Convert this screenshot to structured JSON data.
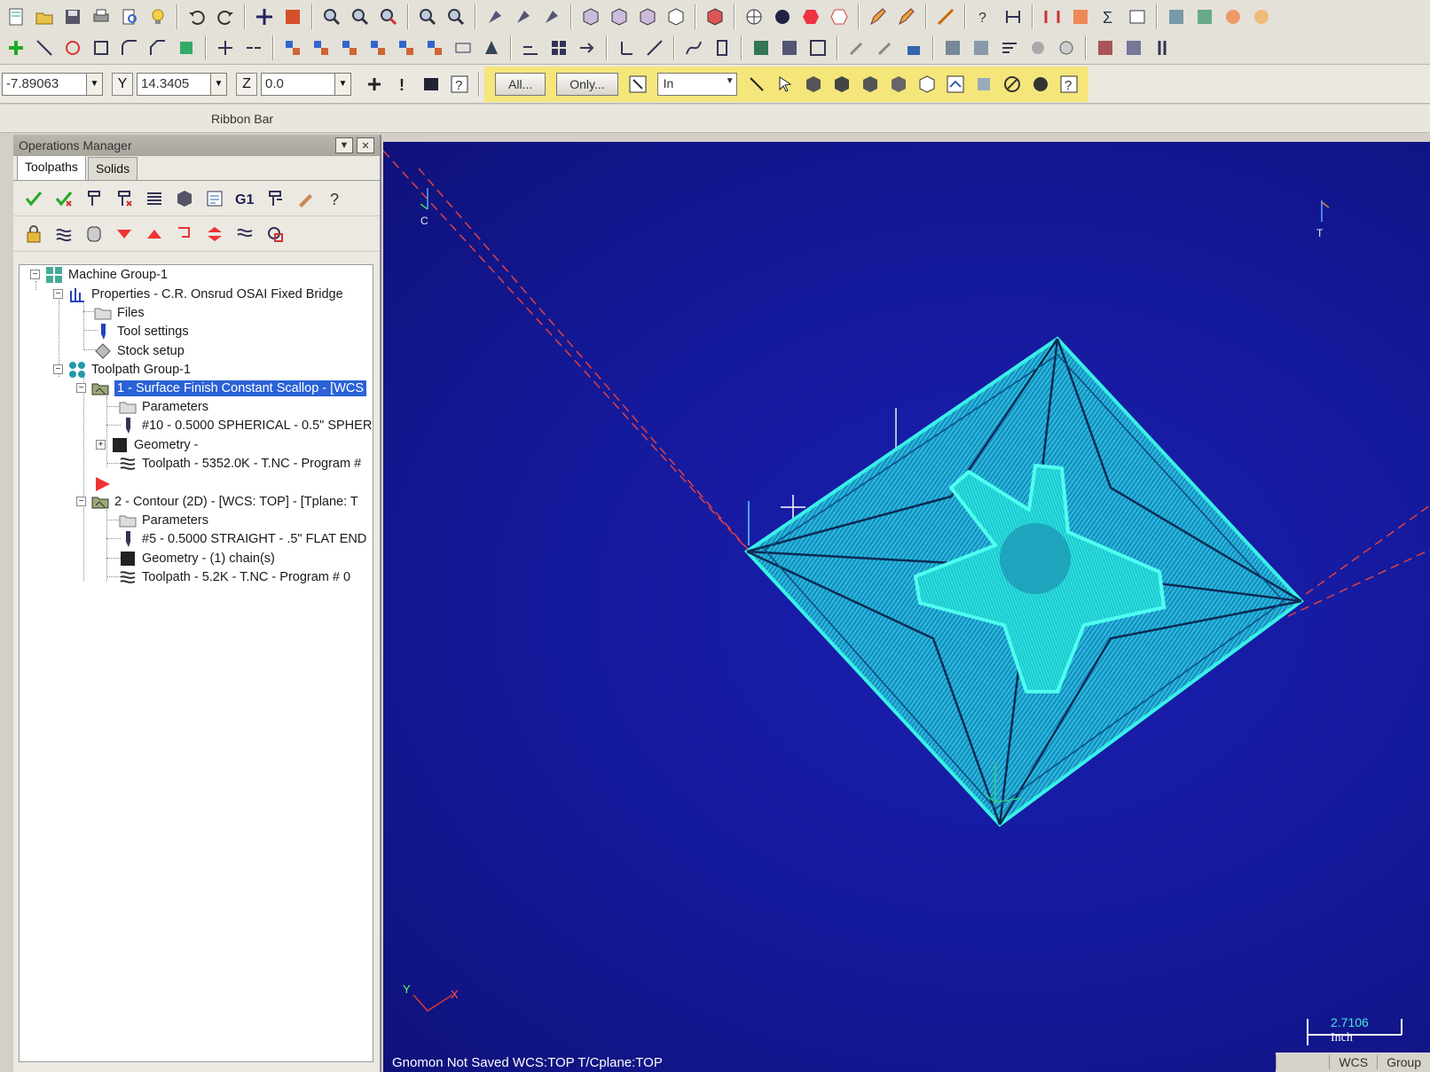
{
  "coords": {
    "x_value": "-7.89063",
    "y_label": "Y",
    "y_value": "14.3405",
    "z_label": "Z",
    "z_value": "0.0"
  },
  "ribbon": {
    "btn_all": "All...",
    "btn_only": "Only...",
    "units_select": "In",
    "label": "Ribbon Bar"
  },
  "ops_manager": {
    "title": "Operations Manager",
    "tabs": [
      "Toolpaths",
      "Solids"
    ],
    "g1_label": "G1",
    "tree": [
      "Machine Group-1",
      "Properties - C.R. Onsrud OSAI Fixed Bridge",
      "Files",
      "Tool settings",
      "Stock setup",
      "Toolpath Group-1",
      "1 - Surface Finish Constant Scallop - [WCS",
      "Parameters",
      "#10 - 0.5000 SPHERICAL - 0.5\" SPHER",
      "Geometry -",
      "Toolpath - 5352.0K - T.NC - Program #",
      "2 - Contour (2D) - [WCS: TOP] - [Tplane: T",
      "Parameters",
      "#5 - 0.5000 STRAIGHT - .5\" FLAT END",
      "Geometry - (1) chain(s)",
      "Toolpath - 5.2K - T.NC - Program # 0"
    ]
  },
  "viewport": {
    "gnomon_top_left": "C",
    "gnomon_top_right": "T",
    "axis_y": "Y",
    "axis_x": "X",
    "scale_value": "2.7106",
    "scale_unit": "Inch",
    "model_color": "#29e8e0",
    "bg_color": "#1418a0"
  },
  "status": {
    "left": "Gnomon Not Saved   WCS:TOP   T/Cplane:TOP",
    "wcs": "WCS",
    "group": "Group"
  }
}
